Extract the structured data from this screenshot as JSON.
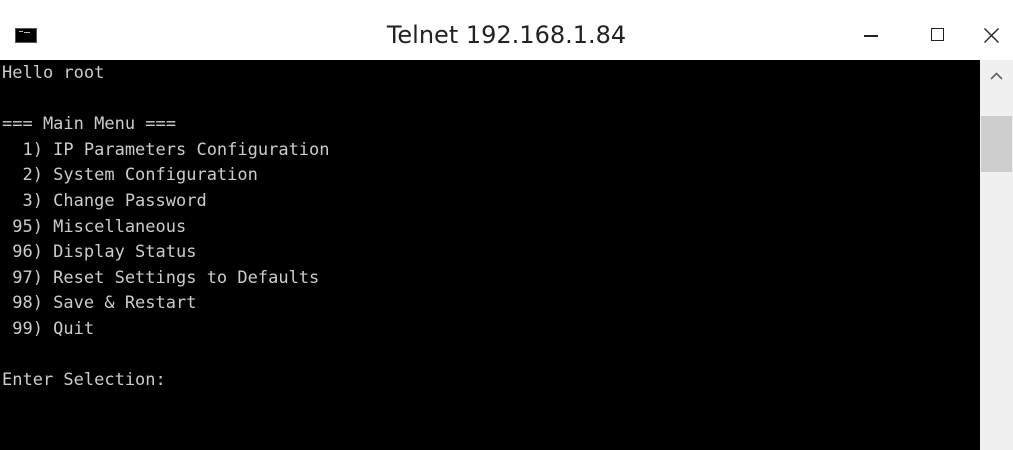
{
  "window": {
    "title": "Telnet 192.168.1.84"
  },
  "icons": {
    "app": "console-icon",
    "minimize": "minimize-icon",
    "maximize": "maximize-icon",
    "close": "close-icon",
    "scroll_up": "chevron-up-icon"
  },
  "console": {
    "lines": [
      "Hello root",
      "",
      "=== Main Menu ===",
      "  1) IP Parameters Configuration",
      "  2) System Configuration",
      "  3) Change Password",
      " 95) Miscellaneous",
      " 96) Display Status",
      " 97) Reset Settings to Defaults",
      " 98) Save & Restart",
      " 99) Quit",
      "",
      "Enter Selection:"
    ]
  },
  "colors": {
    "console_background": "#000000",
    "console_text": "#cccccc",
    "titlebar_background": "#ffffff",
    "scrollbar_track": "#f0f0f0",
    "scrollbar_thumb": "#cdcdcd"
  }
}
